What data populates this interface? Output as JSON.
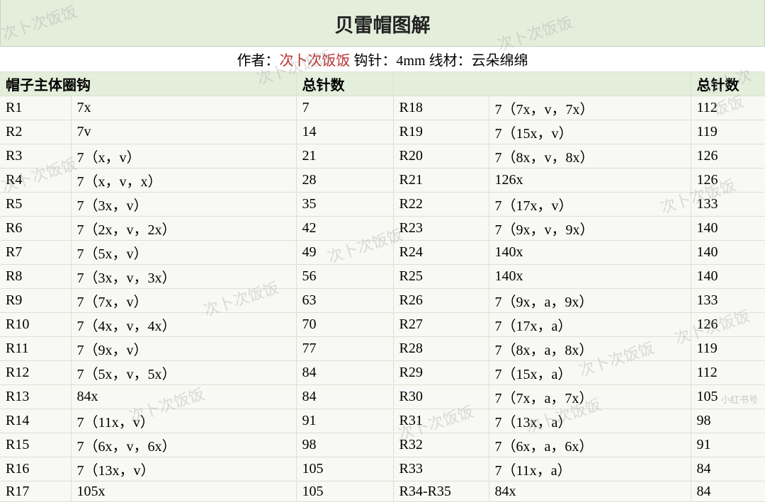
{
  "title": "贝雷帽图解",
  "subtitle": {
    "author_label": "作者：",
    "author_name": "次卜次饭饭",
    "hook": "  钩针：4mm",
    "yarn": " 线材：云朵绵绵"
  },
  "headers": {
    "left_section": "帽子主体圈钩",
    "stitch_count": "总针数"
  },
  "rows_left": [
    {
      "r": "R1",
      "p": "7x",
      "c": "7"
    },
    {
      "r": "R2",
      "p": "7v",
      "c": "14"
    },
    {
      "r": "R3",
      "p": "7（x，v）",
      "c": "21"
    },
    {
      "r": "R4",
      "p": "7（x，v，x）",
      "c": "28"
    },
    {
      "r": "R5",
      "p": "7（3x，v）",
      "c": "35"
    },
    {
      "r": "R6",
      "p": "7（2x，v，2x）",
      "c": "42"
    },
    {
      "r": "R7",
      "p": "7（5x，v）",
      "c": "49"
    },
    {
      "r": "R8",
      "p": "7（3x，v，3x）",
      "c": "56"
    },
    {
      "r": "R9",
      "p": "7（7x，v）",
      "c": "63"
    },
    {
      "r": "R10",
      "p": "7（4x，v，4x）",
      "c": "70"
    },
    {
      "r": "R11",
      "p": "7（9x，v）",
      "c": "77"
    },
    {
      "r": "R12",
      "p": "7（5x，v，5x）",
      "c": "84"
    },
    {
      "r": "R13",
      "p": "84x",
      "c": "84"
    },
    {
      "r": "R14",
      "p": "7（11x，v）",
      "c": "91"
    },
    {
      "r": "R15",
      "p": "7（6x，v，6x）",
      "c": "98"
    },
    {
      "r": "R16",
      "p": "7（13x，v）",
      "c": "105"
    },
    {
      "r": "R17",
      "p": "105x",
      "c": "105"
    }
  ],
  "rows_right": [
    {
      "r": "R18",
      "p": "7（7x，v，7x）",
      "c": "112"
    },
    {
      "r": "R19",
      "p": "7（15x，v）",
      "c": "119"
    },
    {
      "r": "R20",
      "p": "7（8x，v，8x）",
      "c": "126"
    },
    {
      "r": "R21",
      "p": "126x",
      "c": "126"
    },
    {
      "r": "R22",
      "p": "7（17x，v）",
      "c": "133"
    },
    {
      "r": "R23",
      "p": "7（9x，v，9x）",
      "c": "140"
    },
    {
      "r": "R24",
      "p": "140x",
      "c": "140"
    },
    {
      "r": "R25",
      "p": "140x",
      "c": "140"
    },
    {
      "r": "R26",
      "p": "7（9x，a，9x）",
      "c": "133"
    },
    {
      "r": "R27",
      "p": "7（17x，a）",
      "c": "126"
    },
    {
      "r": "R28",
      "p": "7（8x，a，8x）",
      "c": "119"
    },
    {
      "r": "R29",
      "p": "7（15x，a）",
      "c": "112"
    },
    {
      "r": "R30",
      "p": "7（7x，a，7x）",
      "c": "105"
    },
    {
      "r": "R31",
      "p": "7（13x，a）",
      "c": "98"
    },
    {
      "r": "R32",
      "p": "7（6x，a，6x）",
      "c": "91"
    },
    {
      "r": "R33",
      "p": "7（11x，a）",
      "c": "84"
    },
    {
      "r": "R34-R35",
      "p": "84x",
      "c": "84"
    }
  ],
  "watermark_text": "次卜次饭饭",
  "source_tag": "小红书号"
}
